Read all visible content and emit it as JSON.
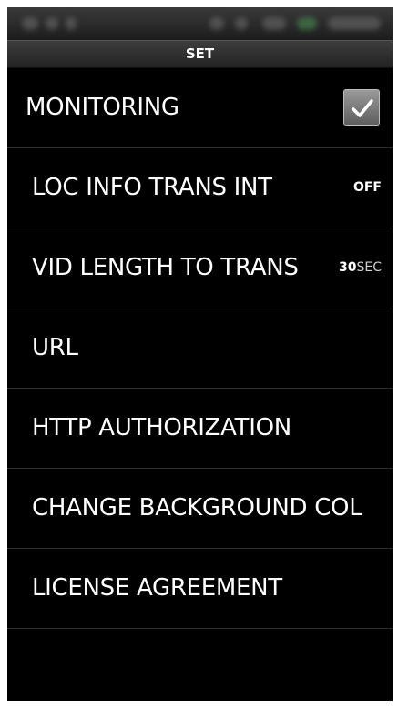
{
  "header": {
    "title": "SET"
  },
  "settings": {
    "items": [
      {
        "label": "MONITORING",
        "control": "checkbox",
        "checked": true
      },
      {
        "label": "LOC INFO TRANS INT",
        "value": "OFF"
      },
      {
        "label": "VID LENGTH TO TRANS",
        "value": "30",
        "unit": "SEC"
      },
      {
        "label": "URL"
      },
      {
        "label": "HTTP AUTHORIZATION"
      },
      {
        "label": "CHANGE BACKGROUND COL"
      },
      {
        "label": "LICENSE AGREEMENT"
      }
    ]
  },
  "icons": {
    "checkbox": "checkmark-icon"
  },
  "colors": {
    "background": "#000000",
    "text": "#ffffff",
    "divider": "#2d2d2d",
    "checkbox_fill": "#7a7a7a"
  }
}
